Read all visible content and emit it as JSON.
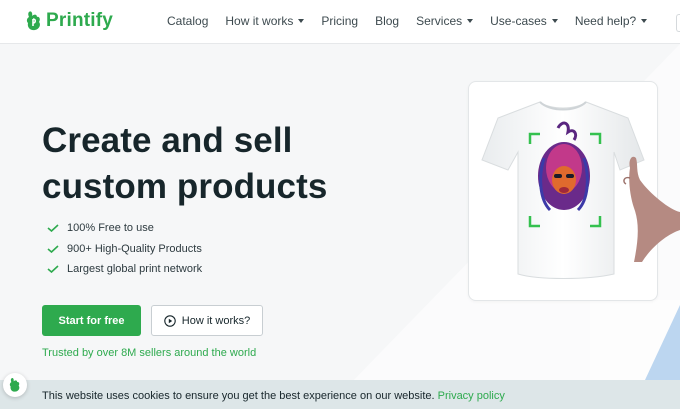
{
  "brand": {
    "name": "Printify",
    "color": "#2eaa4e"
  },
  "nav": {
    "items": [
      {
        "label": "Catalog",
        "dropdown": false
      },
      {
        "label": "How it works",
        "dropdown": true
      },
      {
        "label": "Pricing",
        "dropdown": false
      },
      {
        "label": "Blog",
        "dropdown": false
      },
      {
        "label": "Services",
        "dropdown": true
      },
      {
        "label": "Use-cases",
        "dropdown": true
      },
      {
        "label": "Need help?",
        "dropdown": true
      }
    ]
  },
  "hero": {
    "title_line1": "Create and sell",
    "title_line2": "custom products",
    "features": [
      "100% Free to use",
      "900+ High-Quality Products",
      "Largest global print network"
    ],
    "primary_button": "Start for free",
    "secondary_button": "How it works?",
    "trusted_text": "Trusted by over 8M sellers around the world"
  },
  "cookie": {
    "text": "This website uses cookies to ensure you get the best experience on our website.",
    "link": "Privacy policy"
  },
  "icons": {
    "logo": "printify-logo-icon",
    "check": "check-icon",
    "play": "play-circle-icon",
    "caret": "chevron-down-icon",
    "chat": "printify-chat-icon"
  }
}
